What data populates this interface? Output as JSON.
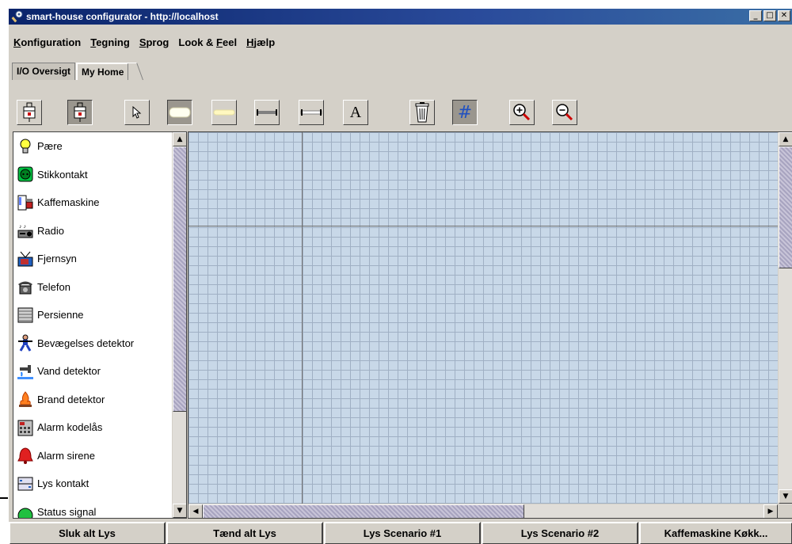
{
  "window": {
    "title": "smart-house configurator - http://localhost",
    "controls": [
      "_",
      "□",
      "✕"
    ]
  },
  "menu": [
    {
      "pre": "",
      "u": "K",
      "post": "onfiguration"
    },
    {
      "pre": "",
      "u": "T",
      "post": "egning"
    },
    {
      "pre": "",
      "u": "S",
      "post": "prog"
    },
    {
      "pre": "Look & ",
      "u": "F",
      "post": "eel"
    },
    {
      "pre": "",
      "u": "H",
      "post": "jælp"
    }
  ],
  "tabs": [
    {
      "label": "I/O Oversigt",
      "active": false
    },
    {
      "label": "My Home",
      "active": true
    }
  ],
  "toolbar": {
    "buttons": [
      "device-light-icon",
      "device-pressed-icon",
      "pointer-icon",
      "room-white-icon",
      "room-yellow-icon",
      "wall-gray-icon",
      "wall-white-icon",
      "text-tool-icon",
      "trash-icon",
      "grid-toggle-icon",
      "zoom-in-icon",
      "zoom-out-icon"
    ],
    "text_tool_glyph": "A",
    "grid_glyph": "#"
  },
  "devices": [
    {
      "label": "Pære",
      "icon": "bulb-icon"
    },
    {
      "label": "Stikkontakt",
      "icon": "socket-icon"
    },
    {
      "label": "Kaffemaskine",
      "icon": "coffee-machine-icon"
    },
    {
      "label": "Radio",
      "icon": "radio-icon"
    },
    {
      "label": "Fjernsyn",
      "icon": "tv-icon"
    },
    {
      "label": "Telefon",
      "icon": "phone-icon"
    },
    {
      "label": "Persienne",
      "icon": "blinds-icon"
    },
    {
      "label": "Bevægelses detektor",
      "icon": "motion-detector-icon"
    },
    {
      "label": "Vand detektor",
      "icon": "water-detector-icon"
    },
    {
      "label": "Brand detektor",
      "icon": "fire-detector-icon"
    },
    {
      "label": "Alarm kodelås",
      "icon": "keypad-icon"
    },
    {
      "label": "Alarm sirene",
      "icon": "siren-icon"
    },
    {
      "label": "Lys kontakt",
      "icon": "light-switch-icon"
    },
    {
      "label": "Status signal",
      "icon": "status-signal-icon"
    }
  ],
  "scenario_buttons": [
    "Sluk alt Lys",
    "Tænd alt Lys",
    "Lys Scenario #1",
    "Lys Scenario #2",
    "Kaffemaskine Køkk..."
  ],
  "colors": {
    "canvas": "#c8d8e8",
    "grid": "#a0b0c4",
    "titlebar": "#0a246a"
  }
}
